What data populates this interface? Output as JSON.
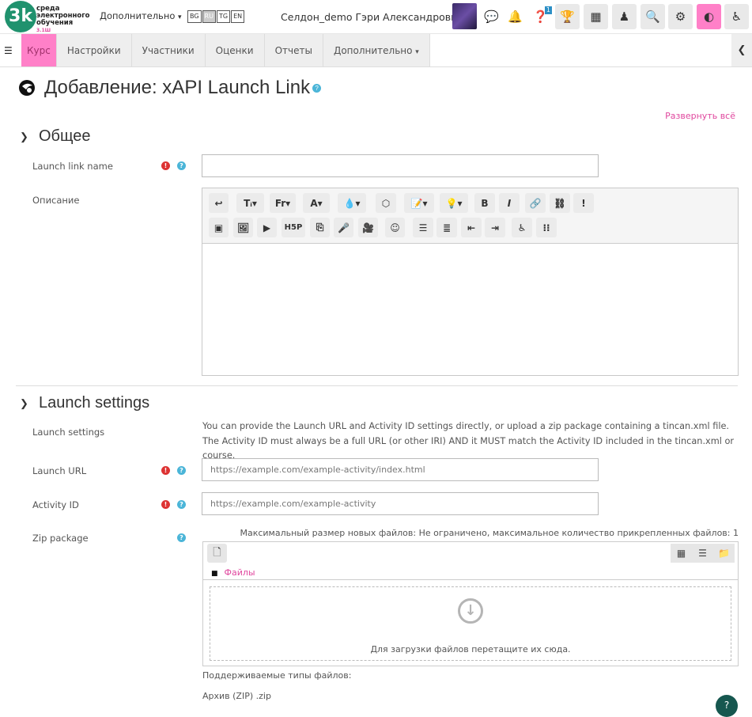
{
  "header": {
    "logo_text": "среда электронного обучения",
    "logo_sub": "3.1Ш",
    "more_menu": "Дополнительно",
    "languages": [
      "BG",
      "RU",
      "TG",
      "EN"
    ],
    "active_language": "RU",
    "username": "Селдон_demo Гэри Александрович",
    "notif_badge": "1",
    "accent_color": "#ff80c8"
  },
  "nav": {
    "tabs": [
      "Курс",
      "Настройки",
      "Участники",
      "Оценки",
      "Отчеты",
      "Дополнительно"
    ],
    "active_tab": "Курс"
  },
  "page": {
    "title": "Добавление: xAPI Launch Link",
    "expand_all": "Развернуть всё"
  },
  "general": {
    "heading": "Общее",
    "launch_link_name_label": "Launch link name",
    "description_label": "Описание"
  },
  "editor": {
    "row1": [
      "↩",
      "Tᵢ▾",
      "Fr▾",
      "A▾",
      "💧▾",
      "⬡",
      "📝▾",
      "💡▾",
      "B",
      "I",
      "🔗",
      "⛓",
      "!"
    ],
    "row2": [
      "▣",
      "🖼",
      "▶",
      "H5P",
      "⎘",
      "🎤",
      "🎥",
      "☺",
      "☰",
      "≣",
      "⇤",
      "⇥",
      "♿",
      "⁝⁝"
    ]
  },
  "launch": {
    "heading": "Launch settings",
    "settings_label": "Launch settings",
    "settings_desc": "You can provide the Launch URL and Activity ID settings directly, or upload a zip package containing a tincan.xml file. The Activity ID must always be a full URL (or other IRI) AND it MUST match the Activity ID included in the tincan.xml or course.",
    "url_label": "Launch URL",
    "url_placeholder": "https://example.com/example-activity/index.html",
    "activity_label": "Activity ID",
    "activity_placeholder": "https://example.com/example-activity",
    "zip_label": "Zip package"
  },
  "filepicker": {
    "max_size": "Максимальный размер новых файлов: Не ограничено, максимальное количество прикрепленных файлов: 1",
    "folder": "Файлы",
    "drop_text": "Для загрузки файлов перетащите их сюда.",
    "types_head": "Поддерживаемые типы файлов:",
    "types_value": "Архив (ZIP) .zip"
  }
}
